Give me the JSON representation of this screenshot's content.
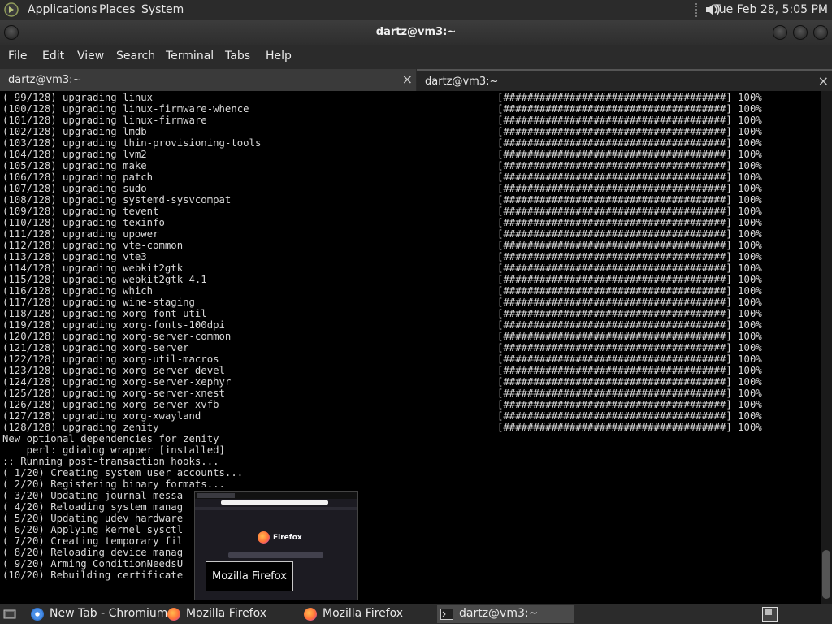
{
  "top_panel": {
    "menus": [
      "Applications",
      "Places",
      "System"
    ],
    "clock": "Tue Feb 28,  5:05 PM",
    "logo_icon": "gnome-foot-icon",
    "volume_icon": "volume-speaker-icon"
  },
  "window": {
    "title": "dartz@vm3:~",
    "buttons": [
      "minimize",
      "maximize",
      "close"
    ]
  },
  "menubar": [
    "File",
    "Edit",
    "View",
    "Search",
    "Terminal",
    "Tabs",
    "Help"
  ],
  "tabs": [
    {
      "label": "dartz@vm3:~",
      "close": "×"
    },
    {
      "label": "dartz@vm3:~",
      "close": "×"
    }
  ],
  "terminal": {
    "progress_bar": "[#####################################]",
    "progress_pct": "100%",
    "upgrades": [
      "( 99/128) upgrading linux",
      "(100/128) upgrading linux-firmware-whence",
      "(101/128) upgrading linux-firmware",
      "(102/128) upgrading lmdb",
      "(103/128) upgrading thin-provisioning-tools",
      "(104/128) upgrading lvm2",
      "(105/128) upgrading make",
      "(106/128) upgrading patch",
      "(107/128) upgrading sudo",
      "(108/128) upgrading systemd-sysvcompat",
      "(109/128) upgrading tevent",
      "(110/128) upgrading texinfo",
      "(111/128) upgrading upower",
      "(112/128) upgrading vte-common",
      "(113/128) upgrading vte3",
      "(114/128) upgrading webkit2gtk",
      "(115/128) upgrading webkit2gtk-4.1",
      "(116/128) upgrading which",
      "(117/128) upgrading wine-staging",
      "(118/128) upgrading xorg-font-util",
      "(119/128) upgrading xorg-fonts-100dpi",
      "(120/128) upgrading xorg-server-common",
      "(121/128) upgrading xorg-server",
      "(122/128) upgrading xorg-util-macros",
      "(123/128) upgrading xorg-server-devel",
      "(124/128) upgrading xorg-server-xephyr",
      "(125/128) upgrading xorg-server-xnest",
      "(126/128) upgrading xorg-server-xvfb",
      "(127/128) upgrading xorg-xwayland",
      "(128/128) upgrading zenity"
    ],
    "tail": [
      "New optional dependencies for zenity",
      "    perl: gdialog wrapper [installed]",
      ":: Running post-transaction hooks...",
      "( 1/20) Creating system user accounts...",
      "( 2/20) Registering binary formats...",
      "( 3/20) Updating journal messa",
      "( 4/20) Reloading system manag",
      "( 5/20) Updating udev hardware",
      "( 6/20) Applying kernel sysctl",
      "( 7/20) Creating temporary fil",
      "( 8/20) Reloading device manag",
      "( 9/20) Arming ConditionNeedsU",
      "(10/20) Rebuilding certificate"
    ]
  },
  "preview": {
    "app_name": "Firefox",
    "tooltip": "Mozilla Firefox",
    "logo_icon": "firefox-logo-icon"
  },
  "taskbar": {
    "items": [
      {
        "label": "New Tab - Chromium",
        "icon": "chromium-icon",
        "color": "#4a8fe7"
      },
      {
        "label": "Mozilla Firefox",
        "icon": "firefox-icon",
        "color": "#ff7139"
      },
      {
        "label": "Mozilla Firefox",
        "icon": "firefox-icon",
        "color": "#ff7139"
      },
      {
        "label": "dartz@vm3:~",
        "icon": "terminal-icon",
        "color": "#555555"
      }
    ],
    "show_desktop_icon": "show-desktop-icon",
    "workspace_icon": "workspace-switcher-icon"
  }
}
